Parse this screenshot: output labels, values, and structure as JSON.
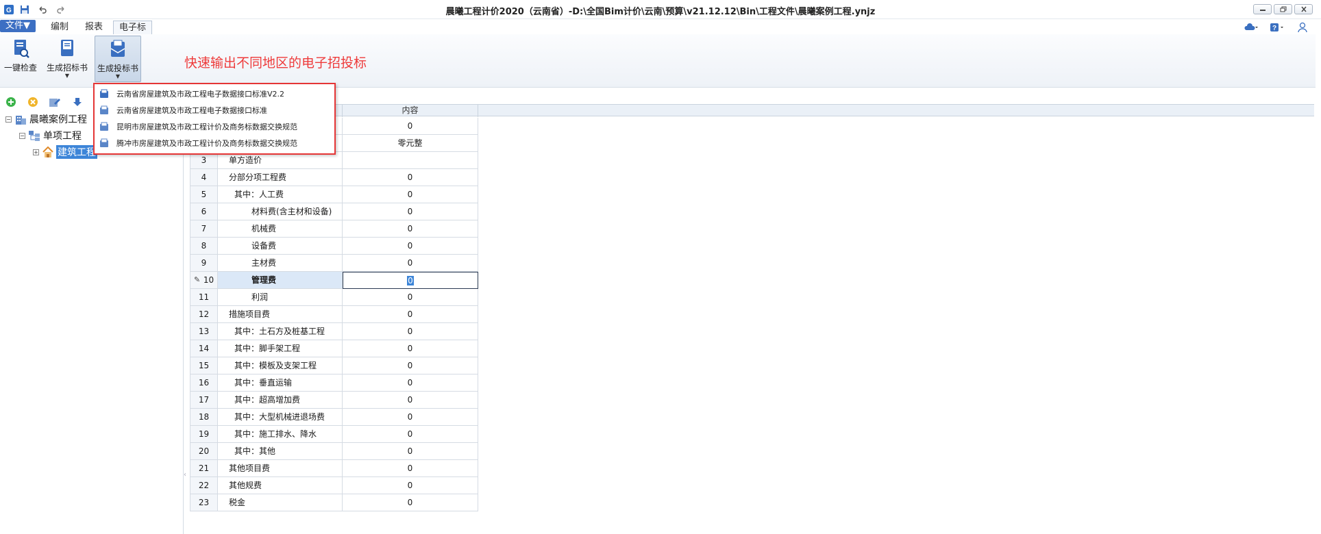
{
  "window": {
    "title": "晨曦工程计价2020（云南省）-D:\\全国Bim计价\\云南\\预算\\v21.12.12\\Bin\\工程文件\\晨曦案例工程.ynjz"
  },
  "menu_tabs": [
    {
      "label": "文件▼"
    },
    {
      "label": "编制"
    },
    {
      "label": "报表"
    },
    {
      "label": "电子标"
    }
  ],
  "ribbon": {
    "buttons": [
      {
        "label": "一键检查",
        "icon": "check-doc-icon"
      },
      {
        "label": "生成招标书",
        "icon": "tender-book-icon",
        "has_dropdown": true
      },
      {
        "label": "生成投标书",
        "icon": "bid-book-icon",
        "has_dropdown": true
      }
    ],
    "hint": "快速输出不同地区的电子招投标"
  },
  "dropdown": {
    "items": [
      {
        "label": "云南省房屋建筑及市政工程电子数据接口标准V2.2"
      },
      {
        "label": "云南省房屋建筑及市政工程电子数据接口标准"
      },
      {
        "label": "昆明市房屋建筑及市政工程计价及商务标数据交换规范"
      },
      {
        "label": "腾冲市房屋建筑及市政工程计价及商务标数据交换规范"
      }
    ]
  },
  "tree": {
    "root": {
      "label": "晨曦案例工程"
    },
    "child": {
      "label": "单项工程"
    },
    "leaf": {
      "label": "建筑工程"
    }
  },
  "grid": {
    "header": {
      "content": "内容"
    },
    "rows": [
      {
        "no": "",
        "name": "",
        "value": "0"
      },
      {
        "no": "",
        "name": "",
        "value": "零元整"
      },
      {
        "no": "3",
        "name": "单方造价",
        "value": ""
      },
      {
        "no": "4",
        "name": "分部分项工程费",
        "value": "0"
      },
      {
        "no": "5",
        "name": "其中：人工费",
        "value": "0"
      },
      {
        "no": "6",
        "name": "材料费(含主材和设备)",
        "value": "0"
      },
      {
        "no": "7",
        "name": "机械费",
        "value": "0"
      },
      {
        "no": "8",
        "name": "设备费",
        "value": "0"
      },
      {
        "no": "9",
        "name": "主材费",
        "value": "0"
      },
      {
        "no": "10",
        "name": "管理费",
        "value": "0"
      },
      {
        "no": "11",
        "name": "利润",
        "value": "0"
      },
      {
        "no": "12",
        "name": "措施项目费",
        "value": "0"
      },
      {
        "no": "13",
        "name": "其中：土石方及桩基工程",
        "value": "0"
      },
      {
        "no": "14",
        "name": "其中：脚手架工程",
        "value": "0"
      },
      {
        "no": "15",
        "name": "其中：模板及支架工程",
        "value": "0"
      },
      {
        "no": "16",
        "name": "其中：垂直运输",
        "value": "0"
      },
      {
        "no": "17",
        "name": "其中：超高增加费",
        "value": "0"
      },
      {
        "no": "18",
        "name": "其中：大型机械进退场费",
        "value": "0"
      },
      {
        "no": "19",
        "name": "其中：施工排水、降水",
        "value": "0"
      },
      {
        "no": "20",
        "name": "其中：其他",
        "value": "0"
      },
      {
        "no": "21",
        "name": "其他项目费",
        "value": "0"
      },
      {
        "no": "22",
        "name": "其他规费",
        "value": "0"
      },
      {
        "no": "23",
        "name": "税金",
        "value": "0"
      }
    ]
  },
  "colors": {
    "accent": "#3c6fc3",
    "hint_red": "#ee3b3b",
    "dropdown_border": "#e53535",
    "selection": "#3d85d8"
  }
}
